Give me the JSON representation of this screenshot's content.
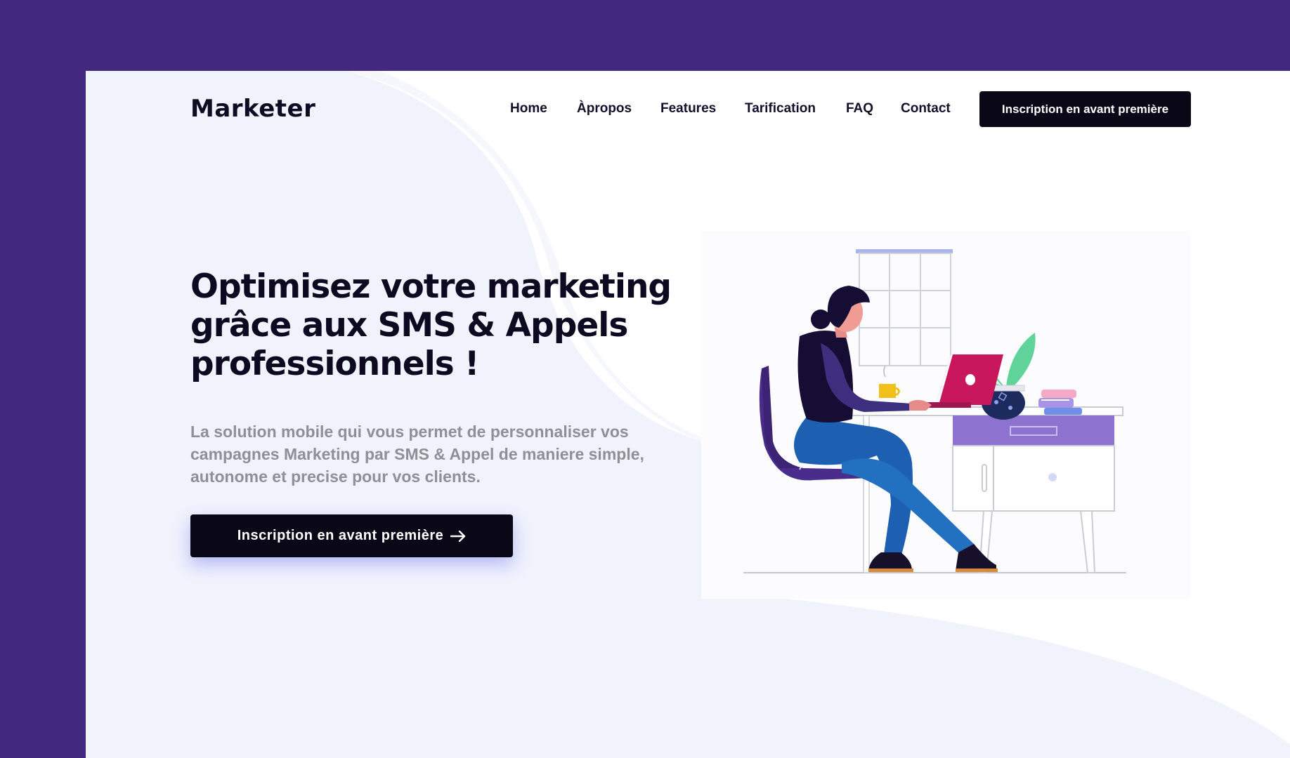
{
  "navbar": {
    "logo": "Marketer",
    "links": [
      "Home",
      "Àpropos",
      "Features",
      "Tarification",
      "FAQ",
      "Contact"
    ],
    "cta_label": "Inscription en avant première"
  },
  "hero": {
    "title_lines": [
      "Optimisez votre marketing",
      "grâce aux SMS & Appels",
      "professionnels !"
    ],
    "subtitle_lines": [
      "La solution mobile qui vous permet de personnaliser vos",
      "campagnes Marketing par SMS & Appel de maniere simple,",
      "autonome et precise pour vos clients."
    ],
    "cta_label": "Inscription en avant première"
  },
  "colors": {
    "outer_background": "#43287f",
    "hero_background": "#f0f2fc",
    "primary_dark": "#0a0716",
    "subtitle_text": "#8f8f95"
  },
  "icons": {
    "cta_arrow": "arrow-right-icon",
    "illustration": "woman-working-at-desk-illustration"
  }
}
